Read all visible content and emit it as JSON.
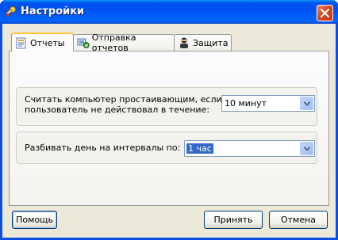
{
  "window": {
    "title": "Настройки",
    "icon": "settings-app-icon"
  },
  "tabs": [
    {
      "label": "Отчеты",
      "icon": "reports-tab-icon",
      "active": true
    },
    {
      "label": "Отправка отчетов",
      "icon": "send-reports-tab-icon",
      "active": false
    },
    {
      "label": "Защита",
      "icon": "security-tab-icon",
      "active": false
    }
  ],
  "reports": {
    "idle_label_line1": "Считать компьютер простаивающим, если",
    "idle_label_line2": "пользователь не действовал в течение:",
    "idle_value": "10 минут",
    "interval_label": "Разбивать день на интервалы по:",
    "interval_value": "1 час"
  },
  "buttons": {
    "help": "Помощь",
    "apply": "Принять",
    "cancel": "Отмена"
  }
}
